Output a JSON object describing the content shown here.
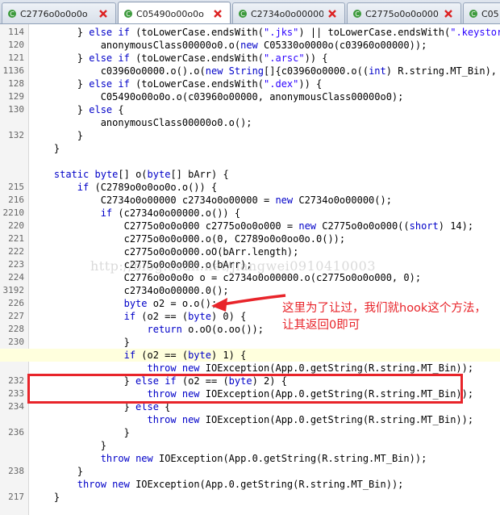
{
  "tabs": [
    {
      "label": "C2776o0o0o0o",
      "active": false,
      "icon": "java-class-icon"
    },
    {
      "label": "C05490o00o0o",
      "active": true,
      "icon": "java-class-icon"
    },
    {
      "label": "C2734o0o00000",
      "active": false,
      "icon": "java-class-icon"
    },
    {
      "label": "C2775o0o0o000",
      "active": false,
      "icon": "java-class-icon"
    },
    {
      "label": "C05",
      "active": false,
      "icon": "java-class-icon"
    }
  ],
  "lines": [
    {
      "num": "114",
      "code": "        } else if (toLowerCase.endsWith(\".jks\") || toLowerCase.endsWith(\".keystore\""
    },
    {
      "num": "120",
      "code": "            anonymousClass00000o0.o(new C05330o0000o(c03960o00000));"
    },
    {
      "num": "121",
      "code": "        } else if (toLowerCase.endsWith(\".arsc\")) {"
    },
    {
      "num": "1136",
      "code": "            c03960o0000.o().o(new String[]{c03960o0000.o((int) R.string.MT_Bin), c"
    },
    {
      "num": "128",
      "code": "        } else if (toLowerCase.endsWith(\".dex\")) {"
    },
    {
      "num": "129",
      "code": "            C05490o00o0o.o(c03960o00000, anonymousClass00000o0);"
    },
    {
      "num": "130",
      "code": "        } else {"
    },
    {
      "num": "",
      "code": "            anonymousClass00000o0.o();"
    },
    {
      "num": "132",
      "code": "        }"
    },
    {
      "num": "",
      "code": "    }"
    },
    {
      "num": "",
      "code": ""
    },
    {
      "num": "",
      "code": "    static byte[] o(byte[] bArr) {"
    },
    {
      "num": "215",
      "code": "        if (C2789o0o0oo0o.o()) {"
    },
    {
      "num": "216",
      "code": "            C2734o0o00000 c2734o0o00000 = new C2734o0o00000();"
    },
    {
      "num": "2210",
      "code": "            if (c2734o0o00000.o()) {"
    },
    {
      "num": "220",
      "code": "                C2775o0o0o000 c2775o0o0o000 = new C2775o0o0o000((short) 14);"
    },
    {
      "num": "221",
      "code": "                c2775o0o0o000.o(0, C2789o0o0oo0o.0());"
    },
    {
      "num": "222",
      "code": "                c2775o0o0o000.oO(bArr.length);"
    },
    {
      "num": "223",
      "code": "                c2775o0o0o000.o(bArr);"
    },
    {
      "num": "224",
      "code": "                C2776o0o0o0o o = c2734o0o00000.o(c2775o0o0o000, 0);"
    },
    {
      "num": "3192",
      "code": "                c2734o0o00000.0();"
    },
    {
      "num": "226",
      "code": "                byte o2 = o.o();"
    },
    {
      "num": "227",
      "code": "                if (o2 == (byte) 0) {"
    },
    {
      "num": "228",
      "code": "                    return o.oO(o.oo());"
    },
    {
      "num": "230",
      "code": "                }"
    },
    {
      "num": "",
      "code": "                if (o2 == (byte) 1) {"
    },
    {
      "num": "",
      "code": "                    throw new IOException(App.0.getString(R.string.MT_Bin));"
    },
    {
      "num": "232",
      "code": "                } else if (o2 == (byte) 2) {"
    },
    {
      "num": "233",
      "code": "                    throw new IOException(App.0.getString(R.string.MT_Bin));"
    },
    {
      "num": "234",
      "code": "                } else {"
    },
    {
      "num": "",
      "code": "                    throw new IOException(App.0.getString(R.string.MT_Bin));"
    },
    {
      "num": "236",
      "code": "                }"
    },
    {
      "num": "",
      "code": "            }"
    },
    {
      "num": "",
      "code": "            throw new IOException(App.0.getString(R.string.MT_Bin));"
    },
    {
      "num": "238",
      "code": "        }"
    },
    {
      "num": "",
      "code": "        throw new IOException(App.0.getString(R.string.MT_Bin));"
    },
    {
      "num": "217",
      "code": "    }"
    }
  ],
  "watermark": "http://blog.csdn.net/jiangwei0910410003",
  "annotation": "这里为了让过，我们就hook这个方法，让其返回0即可",
  "colors": {
    "keyword": "#0000c8",
    "string": "#2a00ff",
    "annotation": "#e8242a",
    "line_highlight": "#ffffdd"
  }
}
